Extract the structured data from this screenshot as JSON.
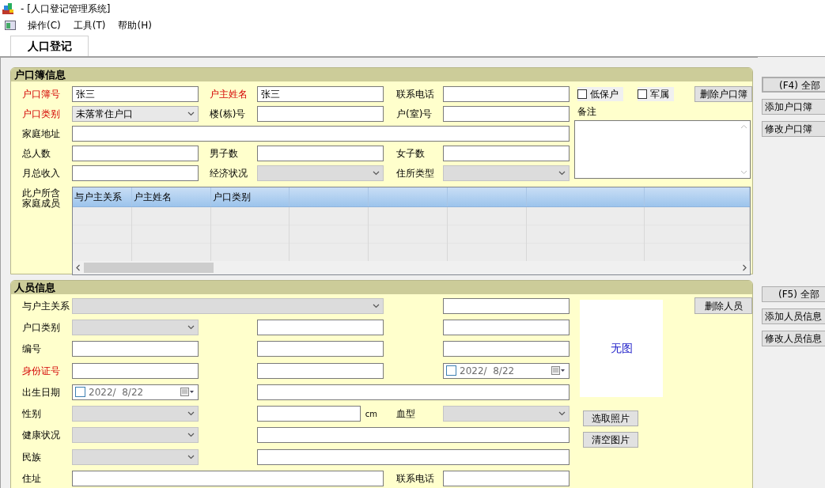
{
  "window": {
    "title": "- [人口登记管理系统]"
  },
  "menu": [
    {
      "label": "操作(C)"
    },
    {
      "label": "工具(T)"
    },
    {
      "label": "帮助(H)"
    }
  ],
  "tabs": [
    {
      "label": "人口登记",
      "selected": true
    }
  ],
  "household": {
    "title": "户口簿信息",
    "lines": [
      {
        "fields": [
          {
            "label": "户口簿号",
            "required": true,
            "kind": "text",
            "value": "张三"
          },
          {
            "label": "户主姓名",
            "required": true,
            "kind": "text",
            "value": "张三"
          },
          {
            "label": "联系电话",
            "required": false,
            "kind": "text"
          }
        ]
      },
      {
        "fields": [
          {
            "label": "户口类别",
            "required": true,
            "kind": "combo",
            "value": "未落常住户口",
            "disabled": false
          },
          {
            "label": "楼(栋)号",
            "required": false,
            "kind": "text"
          },
          {
            "label": "户(室)号",
            "required": false,
            "kind": "text"
          }
        ]
      },
      {
        "fields": [
          {
            "label": "家庭地址",
            "required": false,
            "kind": "text",
            "full": true
          }
        ]
      },
      {
        "fields": [
          {
            "label": "总人数",
            "required": false,
            "kind": "text"
          },
          {
            "label": "男子数",
            "required": false,
            "kind": "text"
          },
          {
            "label": "女子数",
            "required": false,
            "kind": "text"
          }
        ]
      },
      {
        "fields": [
          {
            "label": "月总收入",
            "required": false,
            "kind": "text"
          },
          {
            "label": "经济状况",
            "required": false,
            "kind": "combo",
            "disabled": true
          },
          {
            "label": "住所类型",
            "required": false,
            "kind": "combo",
            "disabled": true
          }
        ]
      }
    ],
    "checkboxes": [
      {
        "label": "低保户",
        "checked": false
      },
      {
        "label": "军属",
        "checked": false
      }
    ],
    "delete_button": "删除户口簿",
    "notes_label": "备注",
    "members": {
      "label": "此户所含家庭成员",
      "columns": [
        {
          "label": "与户主关系"
        },
        {
          "label": "户主姓名"
        },
        {
          "label": "户口类别"
        }
      ]
    }
  },
  "household_buttons": [
    "(F4) 全部",
    "添加户口簿",
    "修改户口簿"
  ],
  "person": {
    "title": "人员信息",
    "lines": [
      {
        "fields": [
          {
            "label": "与户主关系",
            "required": false,
            "kind": "combo",
            "disabled": true,
            "wide": true
          },
          {
            "kind": "text"
          }
        ]
      },
      {
        "fields": [
          {
            "label": "户口类别",
            "required": false,
            "kind": "combo",
            "disabled": true
          },
          {
            "kind": "text"
          },
          {
            "kind": "text"
          }
        ]
      },
      {
        "fields": [
          {
            "label": "编号",
            "required": false,
            "kind": "text"
          },
          {
            "kind": "text"
          },
          {
            "kind": "text"
          }
        ]
      },
      {
        "fields": [
          {
            "label": "身份证号",
            "required": true,
            "kind": "text"
          },
          {
            "kind": "text"
          },
          {
            "kind": "date",
            "value": "2022/  8/22",
            "checked": false
          }
        ]
      },
      {
        "fields": [
          {
            "label": "出生日期",
            "required": false,
            "kind": "date",
            "value": "2022/  8/22",
            "checked": false
          },
          {
            "kind": "text",
            "wide": true
          }
        ]
      },
      {
        "fields": [
          {
            "label": "性别",
            "required": false,
            "kind": "combo",
            "disabled": true
          },
          {
            "kind": "text",
            "unit": "cm"
          },
          {
            "label": "血型",
            "required": false,
            "kind": "combo",
            "disabled": true
          }
        ]
      },
      {
        "fields": [
          {
            "label": "健康状况",
            "required": false,
            "kind": "combo",
            "disabled": true
          },
          {
            "kind": "text",
            "wide": true
          }
        ]
      },
      {
        "fields": [
          {
            "label": "民族",
            "required": false,
            "kind": "combo",
            "disabled": true
          },
          {
            "kind": "text",
            "wide": true
          }
        ]
      },
      {
        "fields": [
          {
            "label": "住址",
            "required": false,
            "kind": "text",
            "wide": true
          },
          {
            "label": "联系电话",
            "required": false,
            "kind": "text"
          }
        ]
      }
    ],
    "delete_button": "删除人员",
    "photo": {
      "placeholder": "无图"
    },
    "photo_buttons": [
      "选取照片",
      "清空图片"
    ]
  },
  "person_buttons": [
    "(F5) 全部",
    "添加人员信息",
    "修改人员信息"
  ]
}
